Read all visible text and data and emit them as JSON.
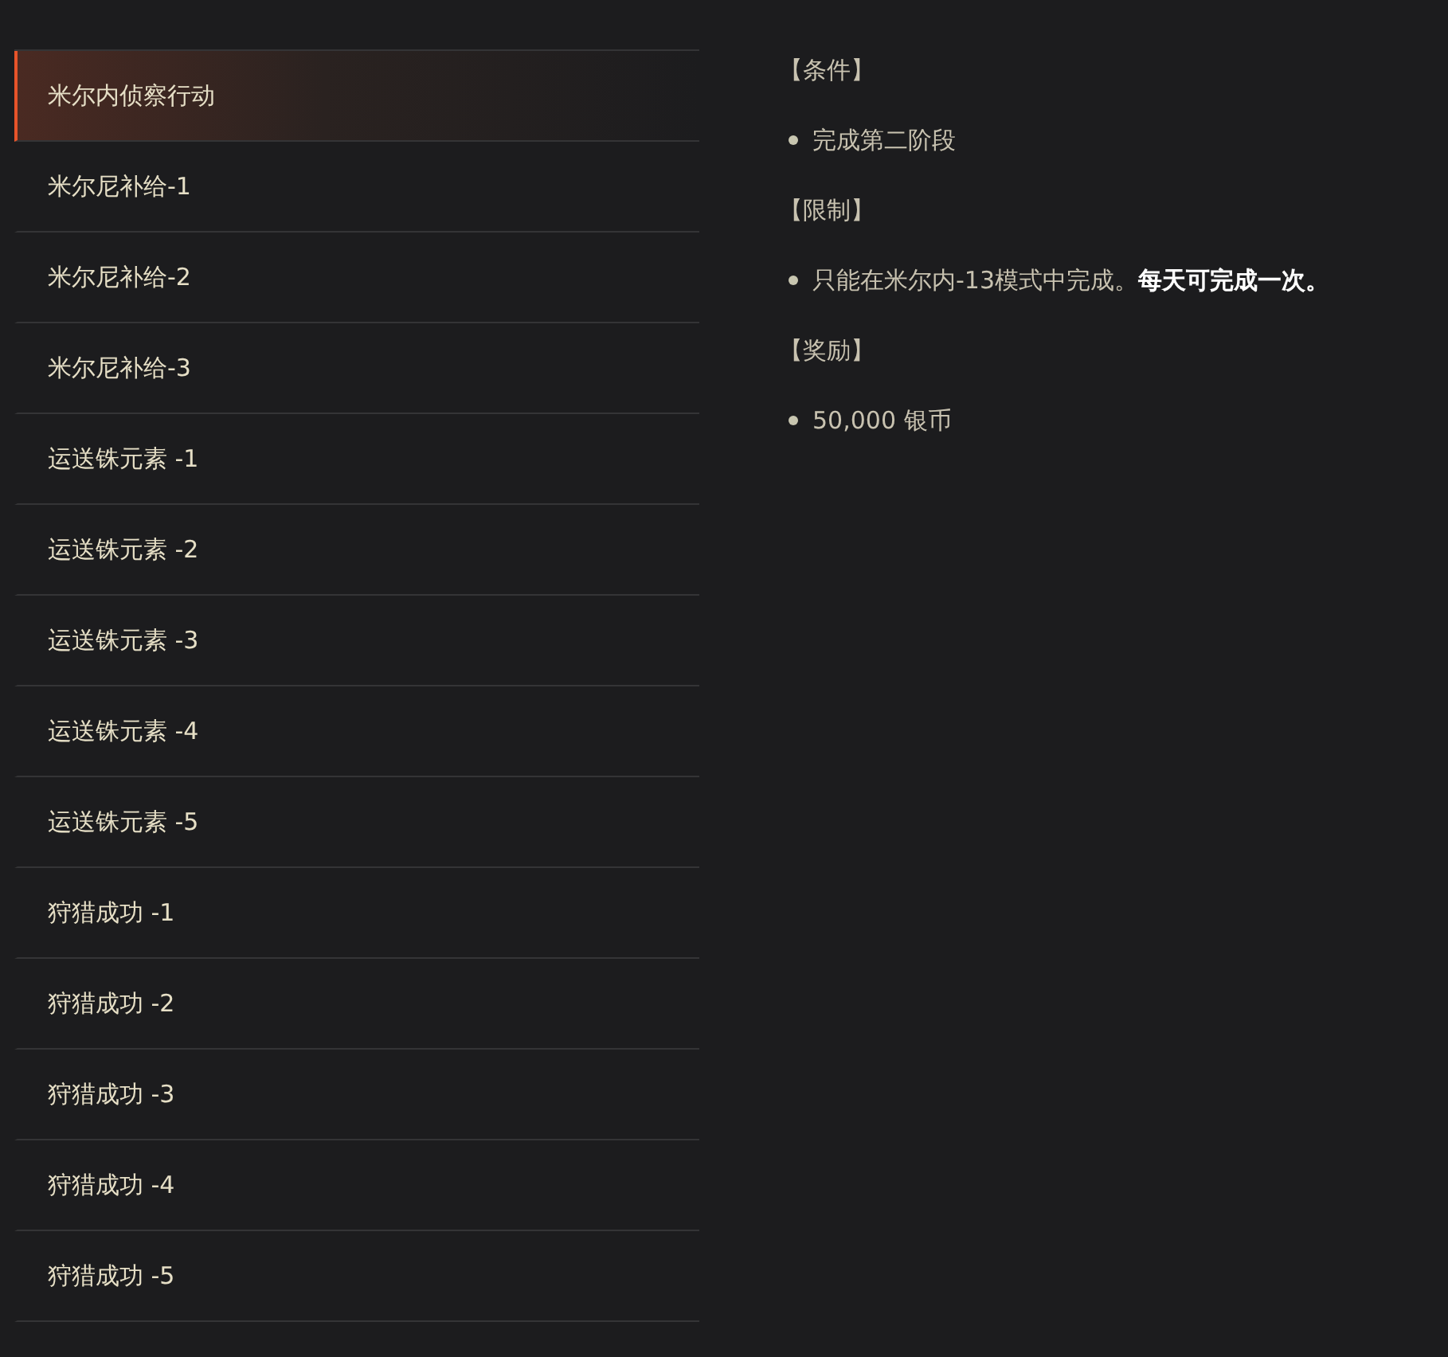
{
  "quests": [
    {
      "label": "米尔内侦察行动",
      "selected": true
    },
    {
      "label": "米尔尼补给-1",
      "selected": false
    },
    {
      "label": "米尔尼补给-2",
      "selected": false
    },
    {
      "label": "米尔尼补给-3",
      "selected": false
    },
    {
      "label": "运送铢元素 -1",
      "selected": false
    },
    {
      "label": "运送铢元素 -2",
      "selected": false
    },
    {
      "label": "运送铢元素 -3",
      "selected": false
    },
    {
      "label": "运送铢元素 -4",
      "selected": false
    },
    {
      "label": "运送铢元素 -5",
      "selected": false
    },
    {
      "label": "狩猎成功 -1",
      "selected": false
    },
    {
      "label": "狩猎成功 -2",
      "selected": false
    },
    {
      "label": "狩猎成功 -3",
      "selected": false
    },
    {
      "label": "狩猎成功 -4",
      "selected": false
    },
    {
      "label": "狩猎成功 -5",
      "selected": false
    }
  ],
  "details": [
    {
      "heading": "【条件】",
      "items": [
        "完成第二阶段"
      ]
    },
    {
      "heading": "【限制】",
      "items": [
        "只能在米尔内-13模式中完成。**每天可完成一次。**"
      ]
    },
    {
      "heading": "【奖励】",
      "items": [
        "50,000 银币"
      ]
    }
  ]
}
